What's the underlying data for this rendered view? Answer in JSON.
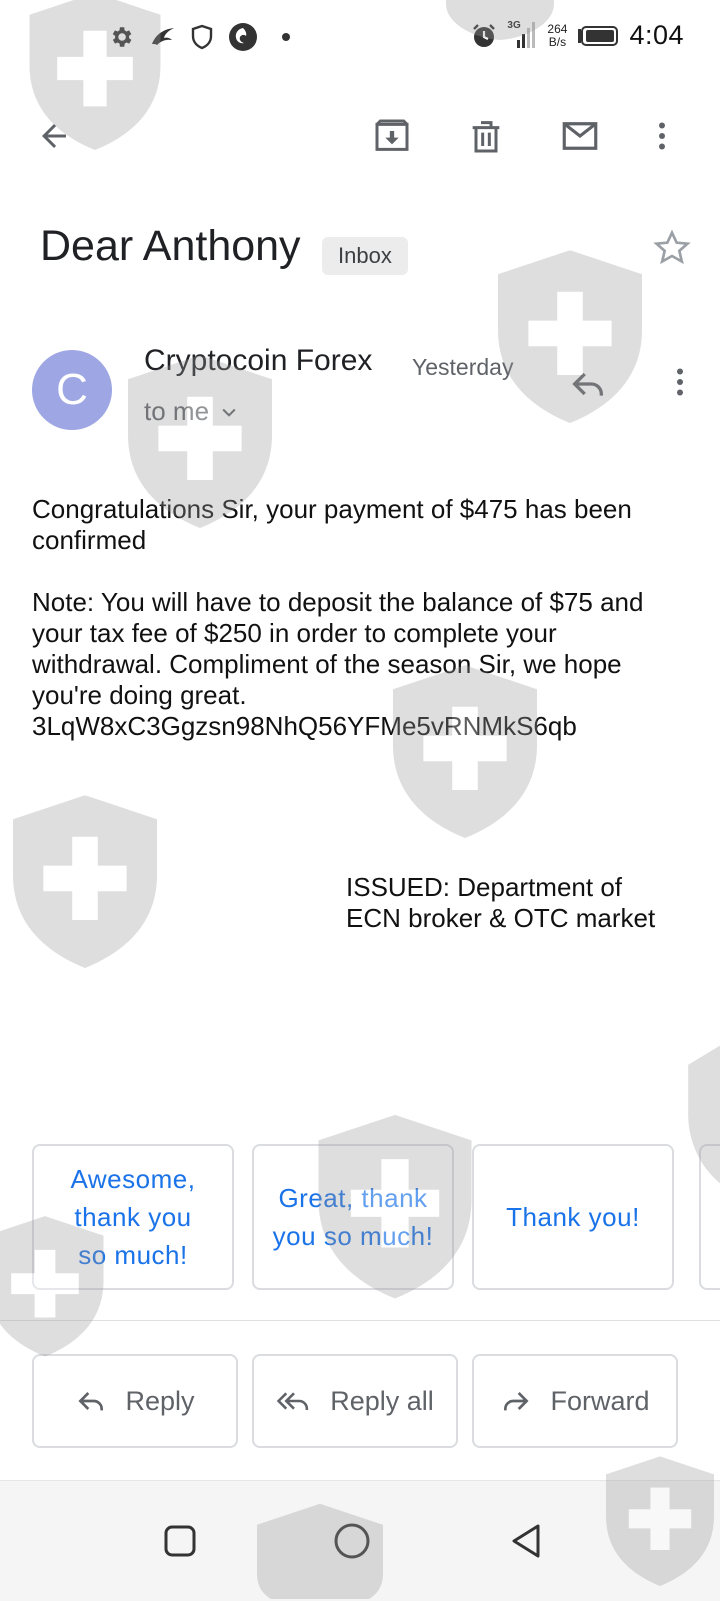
{
  "status_bar": {
    "time": "4:04",
    "net_speed_value": "264",
    "net_speed_unit": "B/s",
    "network_type": "3G",
    "icons": [
      "gear-icon",
      "bird-icon",
      "shield-outline-icon",
      "swirl-app-icon",
      "dot-icon",
      "alarm-icon",
      "signal-icon",
      "battery-icon"
    ]
  },
  "toolbar": {
    "icons": [
      "back-arrow-icon",
      "archive-icon",
      "trash-icon",
      "mail-unread-icon",
      "more-vert-icon"
    ]
  },
  "email": {
    "subject": "Dear Anthony",
    "label_chip": "Inbox",
    "sender_initial": "C",
    "sender_name": "Cryptocoin Forex",
    "date": "Yesterday",
    "recipient": "to me",
    "body_line1": "Congratulations Sir, your payment of $475 has been confirmed",
    "body_line2": "Note: You will have to deposit the balance of $75 and your tax fee of $250 in order to complete your withdrawal. Compliment of the season Sir, we hope you're doing great.",
    "body_line3": "3LqW8xC3Ggzsn98NhQ56YFMe5vRNMkS6qb",
    "issued_line1": "ISSUED: Department of",
    "issued_line2": "ECN broker & OTC market"
  },
  "smart_replies": [
    "Awesome, thank you so much!",
    "Great, thank you so much!",
    "Thank you!"
  ],
  "actions": {
    "reply": "Reply",
    "reply_all": "Reply all",
    "forward": "Forward"
  },
  "colors": {
    "avatar": "#9ea6e3",
    "smart_reply_text": "#1a73e8",
    "secondary_text": "#5f6368"
  }
}
